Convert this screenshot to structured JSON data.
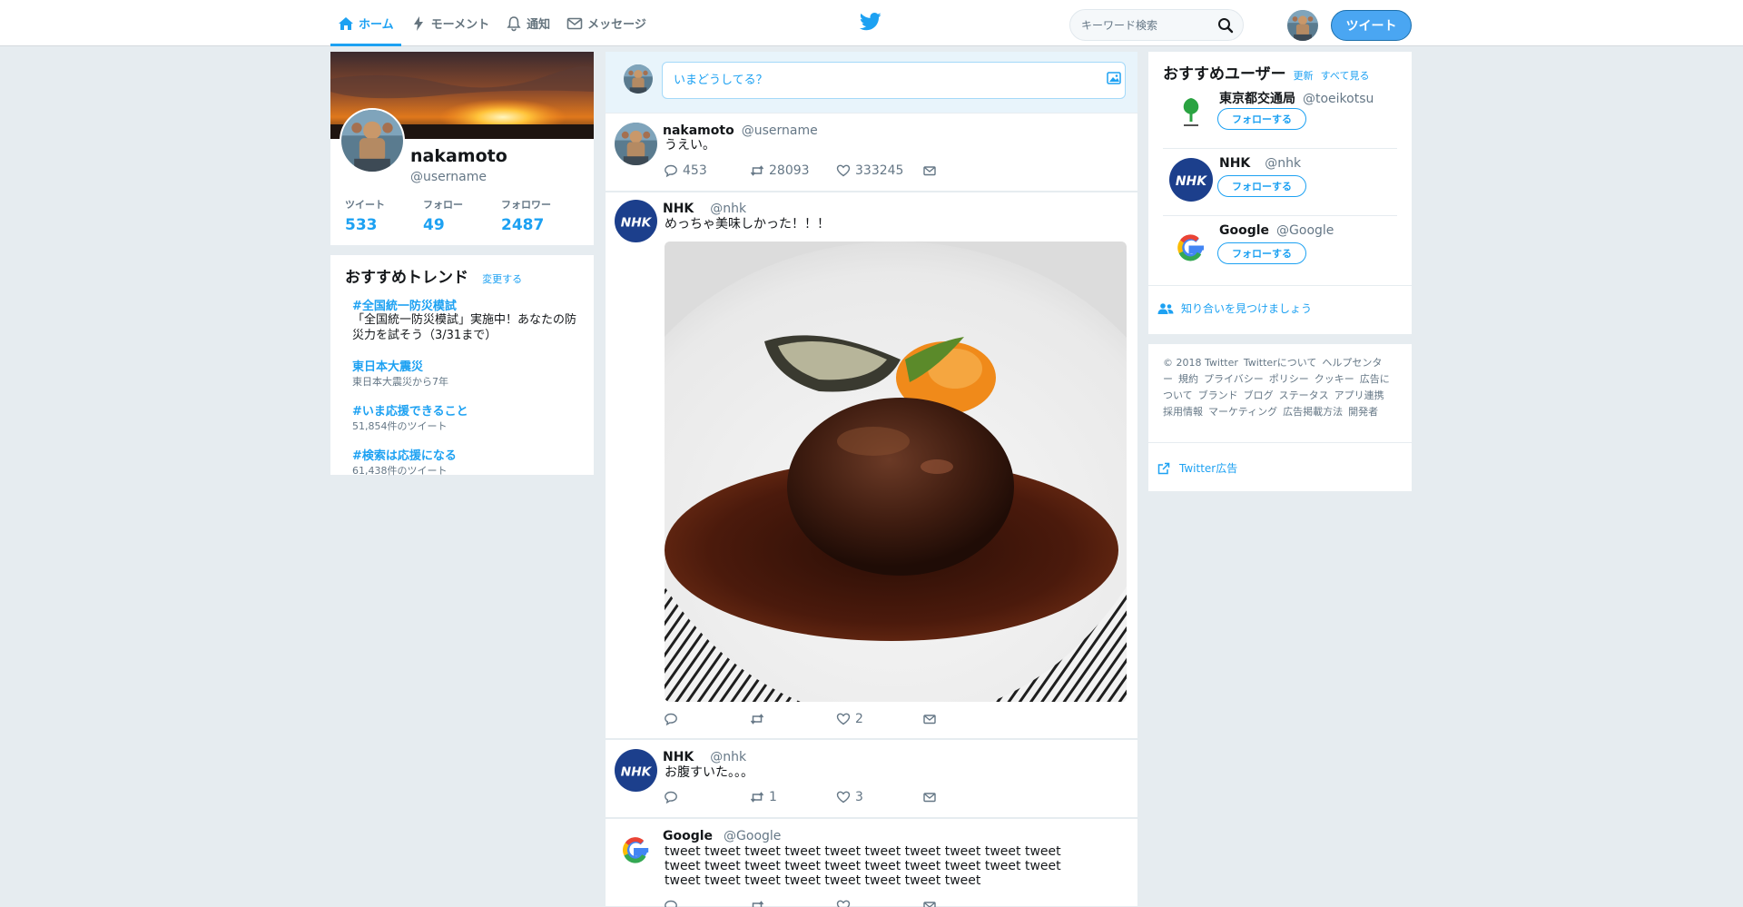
{
  "nav": {
    "home": "ホーム",
    "moments": "モーメント",
    "notifications": "通知",
    "messages": "メッセージ",
    "search_placeholder": "キーワード検索",
    "tweet_button": "ツイート"
  },
  "profile": {
    "name": "nakamoto",
    "handle": "@username",
    "stats": [
      {
        "label": "ツイート",
        "value": "533"
      },
      {
        "label": "フォロー",
        "value": "49"
      },
      {
        "label": "フォロワー",
        "value": "2487"
      }
    ]
  },
  "trends": {
    "title": "おすすめトレンド",
    "change": "変更する",
    "items": [
      {
        "name": "#全国統一防災模試",
        "desc": "「全国統一防災模試」実施中！あなたの防災力を試そう（3/31まで）"
      },
      {
        "name": "東日本大震災",
        "count": "東日本大震災から7年"
      },
      {
        "name": "#いま応援できること",
        "count": "51,854件のツイート"
      },
      {
        "name": "#検索は応援になる",
        "count": "61,438件のツイート"
      }
    ]
  },
  "composer": {
    "placeholder": "いまどうしてる？"
  },
  "tweets": [
    {
      "name": "nakamoto",
      "handle": "@username",
      "text": "うえい。",
      "replies": "453",
      "retweets": "28093",
      "likes": "333245",
      "avatar": "user"
    },
    {
      "name": "NHK",
      "handle": "@nhk",
      "text": "めっちゃ美味しかった！！！",
      "replies": "",
      "retweets": "",
      "likes": "2",
      "avatar": "nhk",
      "image": "hamburg-steak"
    },
    {
      "name": "NHK",
      "handle": "@nhk",
      "text": "お腹すいた。。。",
      "replies": "",
      "retweets": "1",
      "likes": "3",
      "avatar": "nhk"
    },
    {
      "name": "Google",
      "handle": "@Google",
      "text": "tweet tweet tweet tweet tweet tweet tweet tweet tweet tweet tweet tweet tweet tweet tweet tweet tweet tweet tweet tweet tweet tweet tweet tweet tweet tweet tweet tweet",
      "avatar": "google"
    }
  ],
  "who_to_follow": {
    "title": "おすすめユーザー",
    "refresh": "更新",
    "view_all": "すべて見る",
    "follow_label": "フォローする",
    "users": [
      {
        "name": "東京都交通局",
        "handle": "@toeikotsu",
        "avatar": "toei"
      },
      {
        "name": "NHK",
        "handle": "@nhk",
        "avatar": "nhk"
      },
      {
        "name": "Google",
        "handle": "@Google",
        "avatar": "google"
      }
    ],
    "find_friends": "知り合いを見つけましょう"
  },
  "footer": {
    "links": [
      "© 2018 Twitter",
      "Twitterについて",
      "ヘルプセンター",
      "規約",
      "プライバシー",
      "ポリシー",
      "クッキー",
      "広告について",
      "ブランド",
      "ブログ",
      "ステータス",
      "アプリ連携",
      "採用情報",
      "マーケティング",
      "広告掲載方法",
      "開発者"
    ],
    "ads": "Twitter広告"
  },
  "colors": {
    "accent": "#1da1f2",
    "background": "#e6ecf0",
    "nhk_blue": "#1c3f8c"
  }
}
